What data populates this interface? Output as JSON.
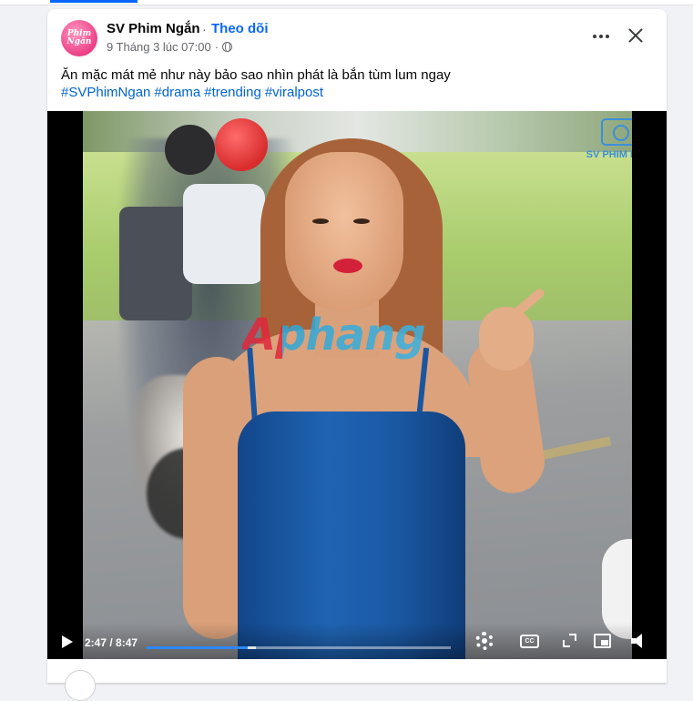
{
  "post": {
    "page_name": "SV Phim Ngắn",
    "separator": "·",
    "follow_label": "Theo dõi",
    "timestamp": "9 Tháng 3 lúc 07:00",
    "meta_separator": "·",
    "audience_icon": "globe-icon",
    "avatar_text": "Phim Ngắn",
    "caption": "Ăn mặc mát mẻ như này bảo sao nhìn phát là bắn tùm lum ngay",
    "hashtags": [
      "#SVPhimNgan",
      "#drama",
      "#trending",
      "#viralpost"
    ]
  },
  "video": {
    "watermark_text": "Aphang",
    "channel_logo_text": "SV PHIM NGẮN",
    "current_time": "2:47",
    "duration": "8:47",
    "time_display": "2:47 / 8:47",
    "played_fraction": 0.3333,
    "buffered_fraction": 0.36,
    "controls": [
      "play-icon",
      "settings-gear-icon",
      "closed-captions-icon",
      "fullscreen-icon",
      "picture-in-picture-icon",
      "volume-icon"
    ],
    "cc_label": "CC"
  },
  "colors": {
    "accent": "#0866ff",
    "hashtag": "#0064d1",
    "progress_played": "#2d88ff",
    "page_bg": "#f0f2f5"
  }
}
